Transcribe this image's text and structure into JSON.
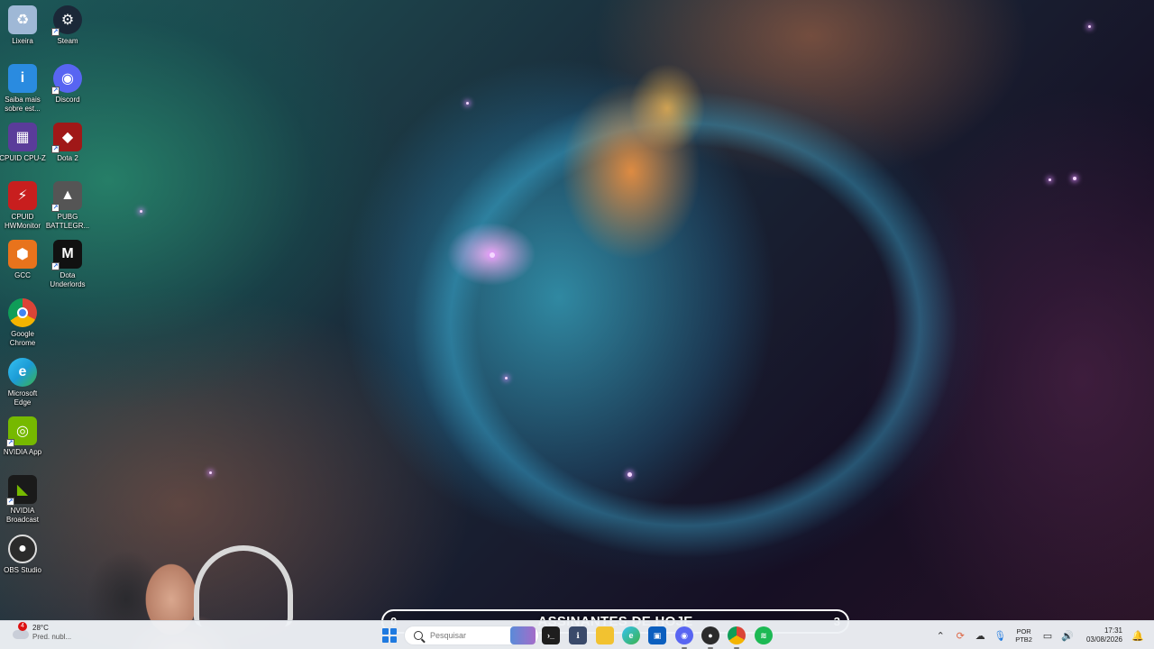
{
  "desktop": {
    "icons": [
      {
        "label": "Lixeira",
        "icon": "recycle-bin-icon",
        "color": "#9fb8d6"
      },
      {
        "label": "Steam",
        "icon": "steam-icon",
        "color": "#1b2838"
      },
      {
        "label": "Saiba mais\nsobre est...",
        "icon": "learn-more-icon",
        "color": "#2a8be0"
      },
      {
        "label": "Discord",
        "icon": "discord-icon",
        "color": "#5865f2"
      },
      {
        "label": "CPUID CPU-Z",
        "icon": "cpu-z-icon",
        "color": "#5a3c9a"
      },
      {
        "label": "Dota 2",
        "icon": "dota2-icon",
        "color": "#a01818"
      },
      {
        "label": "CPUID\nHWMonitor",
        "icon": "hwmonitor-icon",
        "color": "#c81e1e"
      },
      {
        "label": "PUBG\nBATTLEGR...",
        "icon": "pubg-icon",
        "color": "#555555"
      },
      {
        "label": "GCC",
        "icon": "gcc-icon",
        "color": "#e8731c"
      },
      {
        "label": "Dota\nUnderlords",
        "icon": "dota-underlords-icon",
        "color": "#111111"
      },
      {
        "label": "Google\nChrome",
        "icon": "chrome-icon",
        "color": "#e8e8e8"
      },
      {
        "label": "Microsoft\nEdge",
        "icon": "edge-icon",
        "color": "#1c9bd6"
      },
      {
        "label": "NVIDIA App",
        "icon": "nvidia-app-icon",
        "color": "#76b900"
      },
      {
        "label": "NVIDIA\nBroadcast",
        "icon": "nvidia-broadcast-icon",
        "color": "#1a1a1a"
      },
      {
        "label": "OBS Studio",
        "icon": "obs-icon",
        "color": "#2b2b2b"
      }
    ]
  },
  "overlay": {
    "title": "ASSINANTES DE HOJE",
    "left_value": "0",
    "right_value": "3",
    "progress": 0.0
  },
  "taskbar": {
    "weather": {
      "temperature": "28°C",
      "condition": "Pred. nubl...",
      "badge": "4"
    },
    "search_placeholder": "Pesquisar",
    "apps": [
      {
        "name": "start-menu",
        "icon": "windows-icon"
      },
      {
        "name": "widgets",
        "icon": "widgets-icon"
      },
      {
        "name": "terminal",
        "icon": "terminal-icon"
      },
      {
        "name": "hwinfo",
        "icon": "hwinfo-icon"
      },
      {
        "name": "file-explorer",
        "icon": "folder-icon"
      },
      {
        "name": "edge",
        "icon": "edge-icon"
      },
      {
        "name": "store",
        "icon": "store-icon"
      },
      {
        "name": "discord",
        "icon": "discord-icon"
      },
      {
        "name": "obs",
        "icon": "obs-icon"
      },
      {
        "name": "chrome",
        "icon": "chrome-icon"
      },
      {
        "name": "spotify",
        "icon": "spotify-icon"
      }
    ],
    "language": {
      "line1": "POR",
      "line2": "PTB2"
    },
    "clock": {
      "time": "17:31",
      "date": "03/08/2026"
    }
  },
  "colors": {
    "taskbar_bg": "#eef1f6",
    "windows_blue": "#1f7ae0",
    "overlay_border": "#ffffff"
  }
}
